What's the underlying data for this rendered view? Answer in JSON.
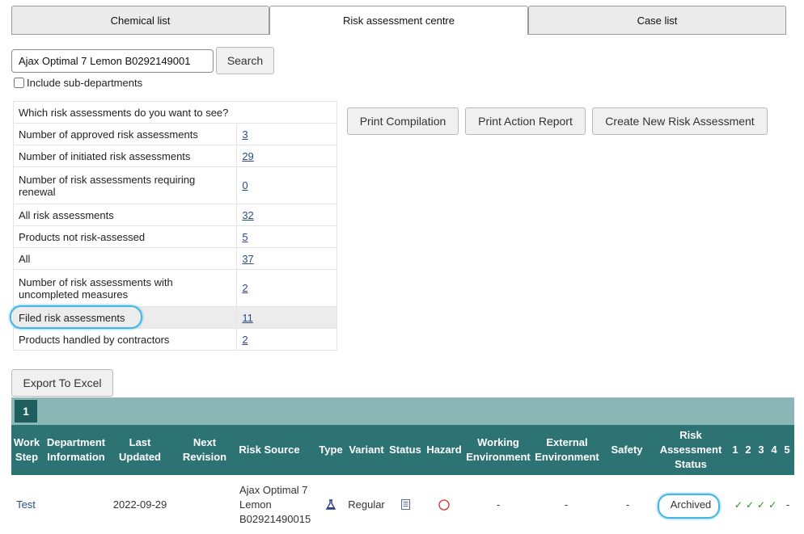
{
  "tabs": [
    {
      "label": "Chemical list"
    },
    {
      "label": "Risk assessment centre"
    },
    {
      "label": "Case list"
    }
  ],
  "search": {
    "value": "Ajax Optimal 7 Lemon B0292149001",
    "button_label": "Search",
    "include_subdepartments_label": "Include sub-departments"
  },
  "stats": {
    "header": "Which risk assessments do you want to see?",
    "rows": [
      {
        "label": "Number of approved risk assessments",
        "value": "3"
      },
      {
        "label": "Number of initiated risk assessments",
        "value": "29"
      },
      {
        "label": "Number of risk assessments requiring renewal",
        "value": "0"
      },
      {
        "label": "All risk assessments",
        "value": "32"
      },
      {
        "label": "Products not risk-assessed",
        "value": "5"
      },
      {
        "label": "All",
        "value": "37"
      },
      {
        "label": "Number of risk assessments with uncompleted measures",
        "value": "2"
      },
      {
        "label": "Filed risk assessments",
        "value": "11"
      },
      {
        "label": "Products handled by contractors",
        "value": "2"
      }
    ]
  },
  "actions": {
    "print_compilation": "Print Compilation",
    "print_action_report": "Print Action Report",
    "create_new": "Create New Risk Assessment",
    "export_excel": "Export To Excel"
  },
  "pager": {
    "current_page": "1"
  },
  "grid": {
    "headers": {
      "work_step": "Work Step",
      "department": "Department Information",
      "last_updated": "Last Updated",
      "next_revision": "Next Revision",
      "risk_source": "Risk Source",
      "type": "Type",
      "variant": "Variant",
      "status": "Status",
      "hazard": "Hazard",
      "working_env": "Working Environment",
      "external_env": "External Environment",
      "safety": "Safety",
      "ra_status": "Risk Assessment Status",
      "c1": "1",
      "c2": "2",
      "c3": "3",
      "c4": "4",
      "c5": "5"
    },
    "rows": [
      {
        "work_step": "Test",
        "department": "2022-09-29",
        "last_updated": "",
        "risk_source": "Ajax Optimal 7 Lemon B02921490015",
        "variant": "Regular",
        "working_env": "-",
        "external_env": "-",
        "safety": "-",
        "ra_status": "Archived",
        "c5": "-"
      }
    ]
  },
  "colors": {
    "teal_dark": "#2d7373",
    "teal_light": "#8ab6b6",
    "link": "#2a4a8c",
    "highlight": "#45b6e0"
  }
}
